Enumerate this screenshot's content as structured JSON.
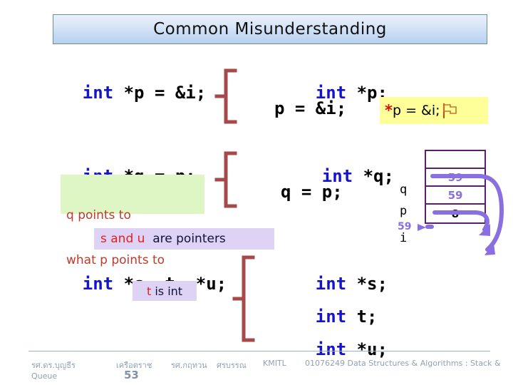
{
  "slide": {
    "title": "Common Misunderstanding"
  },
  "left_column": {
    "line1_kw": "int",
    "line1_rest": " *p = &i;",
    "line2_kw": "int",
    "line2_rest": " *q = p;",
    "line3_kw": "int",
    "line3_rest": " *s, t, *u;"
  },
  "right_column": {
    "line1_kw": "int",
    "line1_rest": " *p;",
    "line2": "p = &i;",
    "line3_kw": "int",
    "line3_rest": " *q;",
    "line4": "q = p;",
    "line5_kw": "int",
    "line5_rest": " *s;",
    "line6_kw": "int",
    "line6_rest": " t;",
    "line7_kw": "int",
    "line7_rest": " *u;"
  },
  "callouts": {
    "yellow": {
      "star": "*",
      "text": "p = &i;",
      "icon": "flag-icon"
    },
    "green": {
      "line1": "q points to",
      "line2": "what p points to"
    },
    "lavender_pointers": {
      "emph": "s and u",
      "rest": "  are pointers"
    },
    "lavender_int": {
      "emph": "t",
      "rest": " is int"
    }
  },
  "memory": {
    "labels": [
      "q",
      "p",
      "i"
    ],
    "purple_note": "59",
    "rows": [
      {
        "value": "",
        "color": "purple"
      },
      {
        "value": "59",
        "color": "purple"
      },
      {
        "value": "59",
        "color": "purple"
      },
      {
        "value": "8",
        "color": "black"
      }
    ]
  },
  "footer": {
    "author1": "รศ.ดร.บุญธีร",
    "author2": "เครือตราช",
    "author3": "รศ.กฤทวน",
    "author4": "ศรบรรณ",
    "org": "KMITL",
    "course": "01076249 Data Structures & Algorithms : Stack &",
    "course_cont": "Queue",
    "page": "53"
  },
  "colors": {
    "keyword": "#1414cf",
    "brace": "#a44a4a",
    "table_border": "#5b1f6e",
    "arrow": "#8a6fe0",
    "yellow_box": "#ffff99",
    "green_box": "#ddf6c4",
    "lavender_box": "#ded3f5"
  }
}
